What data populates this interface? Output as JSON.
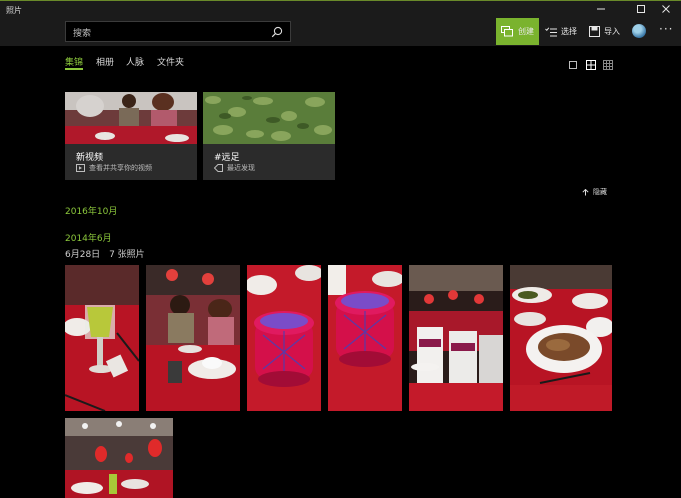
{
  "app": {
    "title": "照片"
  },
  "search": {
    "placeholder": "搜索"
  },
  "commands": {
    "create": "创建",
    "select": "选择",
    "import": "导入",
    "more": "···"
  },
  "tabs": [
    {
      "label": "集锦",
      "active": true
    },
    {
      "label": "相册",
      "active": false
    },
    {
      "label": "人脉",
      "active": false
    },
    {
      "label": "文件夹",
      "active": false
    }
  ],
  "cards": [
    {
      "title": "新视频",
      "subtitle": "查看并共享你的视频",
      "icon": "video-icon"
    },
    {
      "title": "#远足",
      "subtitle": "最近发现",
      "icon": "tag-icon"
    }
  ],
  "hide_label": "隐藏",
  "sections": [
    {
      "title": "2016年10月"
    },
    {
      "title": "2014年6月",
      "date": "6月28日",
      "count": "7 张照片"
    }
  ],
  "colors": {
    "accent": "#7ab32e",
    "accent_text": "#8cc83c",
    "titlebar": "#1b1b1b",
    "card": "#2b2b2b"
  },
  "photos": [
    {
      "name": "photo-table-drink"
    },
    {
      "name": "photo-child-table"
    },
    {
      "name": "photo-red-box"
    },
    {
      "name": "photo-red-box-2"
    },
    {
      "name": "photo-banquet-hall"
    },
    {
      "name": "photo-dishes"
    },
    {
      "name": "photo-hall-lanterns"
    }
  ]
}
